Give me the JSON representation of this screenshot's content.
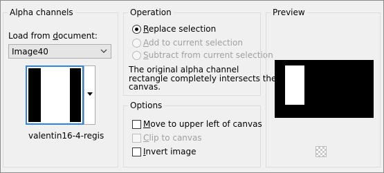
{
  "alpha_channels": {
    "title": "Alpha channels",
    "load_label_pre": "Load from ",
    "load_label_accel": "d",
    "load_label_post": "ocument:",
    "document_value": "Image40",
    "channel_name": "valentin16-4-regis"
  },
  "operation": {
    "title": "Operation",
    "replace": {
      "accel": "R",
      "rest": "eplace selection",
      "selected": true
    },
    "add": {
      "accel": "A",
      "rest": "dd to current selection",
      "enabled": false
    },
    "subtract": {
      "accel": "S",
      "rest": "ubtract from current selection",
      "enabled": false
    },
    "message_line1": "The original alpha channel",
    "message_line2": "rectangle completely intersects the",
    "message_line3": "canvas."
  },
  "options": {
    "title": "Options",
    "move": {
      "accel": "M",
      "rest": "ove to upper left of canvas",
      "checked": false
    },
    "clip": {
      "accel": "C",
      "rest": "lip to canvas",
      "enabled": false
    },
    "invert": {
      "accel": "I",
      "rest": "nvert image",
      "checked": false
    }
  },
  "preview": {
    "title": "Preview",
    "transparency_icon": "checkerboard-icon"
  },
  "colors": {
    "selection_border": "#2f83e6",
    "disabled_text": "#a0a0a0"
  }
}
